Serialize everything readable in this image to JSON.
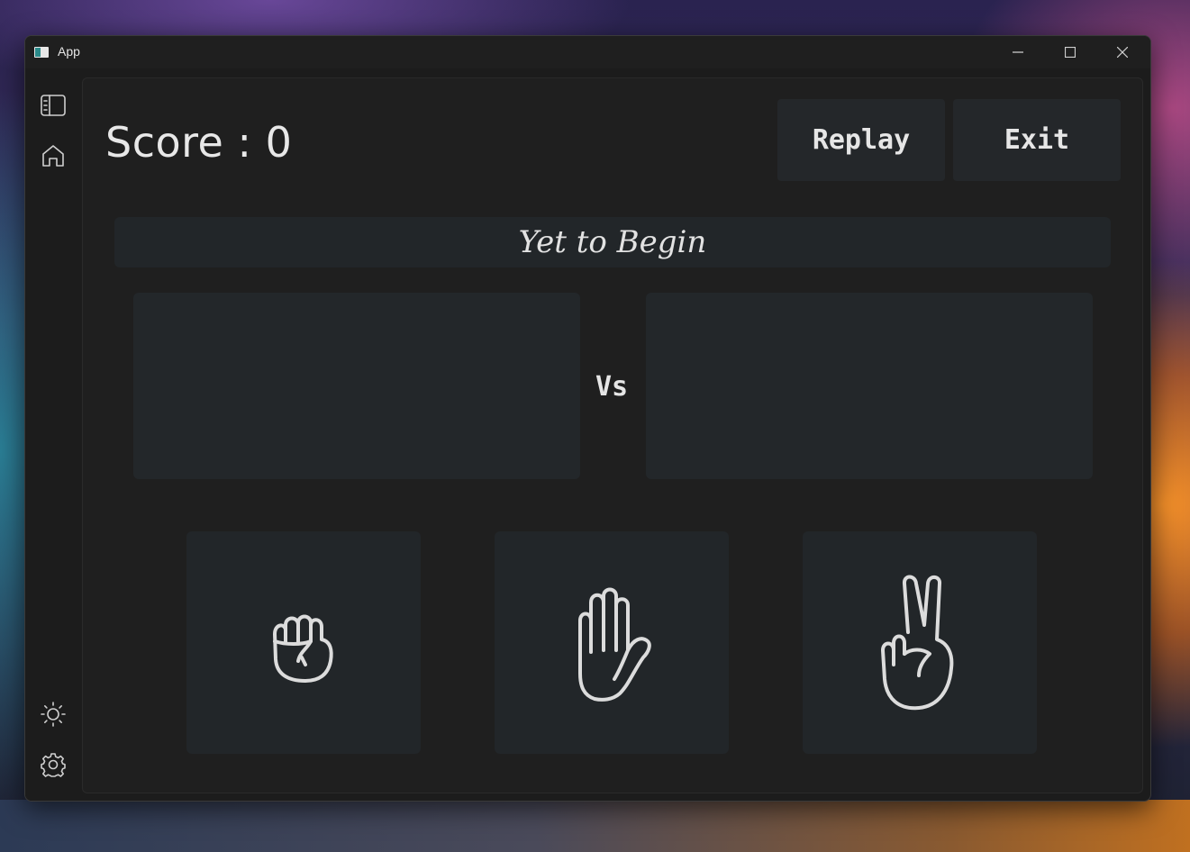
{
  "window": {
    "title": "App"
  },
  "game": {
    "score_text": "Score : 0",
    "replay_label": "Replay",
    "exit_label": "Exit",
    "status_text": "Yet to Begin",
    "vs_label": "Vs"
  },
  "sidebar": {
    "items": [
      {
        "name": "toggle-sidebar-icon"
      },
      {
        "name": "home-icon"
      },
      {
        "name": "theme-sun-icon"
      },
      {
        "name": "settings-gear-icon"
      }
    ]
  },
  "choices": [
    "rock-fist-icon",
    "paper-hand-icon",
    "scissors-victory-icon"
  ]
}
